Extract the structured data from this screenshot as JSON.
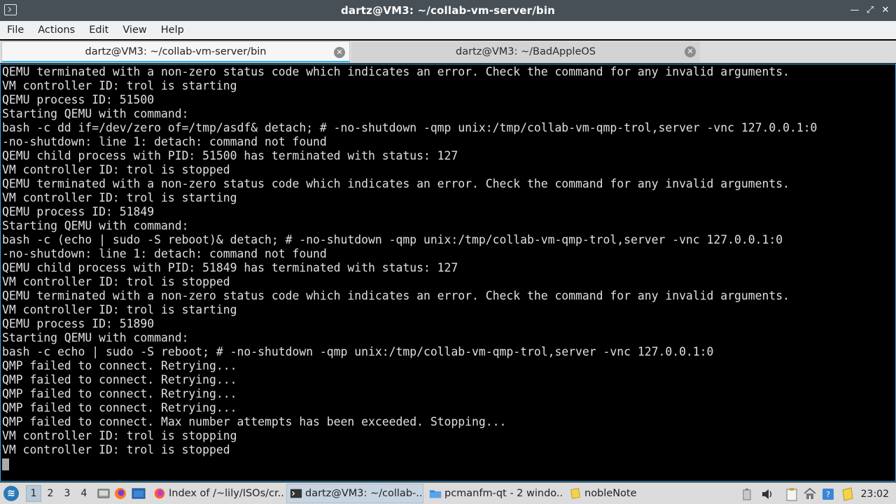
{
  "window": {
    "title": "dartz@VM3: ~/collab-vm-server/bin",
    "icon": "terminal-icon"
  },
  "menu": [
    "File",
    "Actions",
    "Edit",
    "View",
    "Help"
  ],
  "tabs": [
    {
      "label": "dartz@VM3: ~/collab-vm-server/bin",
      "active": true
    },
    {
      "label": "dartz@VM3: ~/BadAppleOS",
      "active": false
    }
  ],
  "terminal": {
    "lines": [
      "QEMU terminated with a non-zero status code which indicates an error. Check the command for any invalid arguments.",
      "VM controller ID: trol is starting",
      "QEMU process ID: 51500",
      "Starting QEMU with command:",
      "bash -c dd if=/dev/zero of=/tmp/asdf& detach; # -no-shutdown -qmp unix:/tmp/collab-vm-qmp-trol,server -vnc 127.0.0.1:0",
      "-no-shutdown: line 1: detach: command not found",
      "QEMU child process with PID: 51500 has terminated with status: 127",
      "VM controller ID: trol is stopped",
      "QEMU terminated with a non-zero status code which indicates an error. Check the command for any invalid arguments.",
      "VM controller ID: trol is starting",
      "QEMU process ID: 51849",
      "Starting QEMU with command:",
      "bash -c (echo | sudo -S reboot)& detach; # -no-shutdown -qmp unix:/tmp/collab-vm-qmp-trol,server -vnc 127.0.0.1:0",
      "-no-shutdown: line 1: detach: command not found",
      "QEMU child process with PID: 51849 has terminated with status: 127",
      "VM controller ID: trol is stopped",
      "QEMU terminated with a non-zero status code which indicates an error. Check the command for any invalid arguments.",
      "VM controller ID: trol is starting",
      "QEMU process ID: 51890",
      "Starting QEMU with command:",
      "bash -c echo | sudo -S reboot; # -no-shutdown -qmp unix:/tmp/collab-vm-qmp-trol,server -vnc 127.0.0.1:0",
      "QMP failed to connect. Retrying...",
      "QMP failed to connect. Retrying...",
      "QMP failed to connect. Retrying...",
      "QMP failed to connect. Retrying...",
      "QMP failed to connect. Max number attempts has been exceeded. Stopping...",
      "VM controller ID: trol is stopping",
      "VM controller ID: trol is stopped"
    ]
  },
  "taskbar": {
    "desktops": [
      "1",
      "2",
      "3",
      "4"
    ],
    "active_desktop": "1",
    "tasks": [
      {
        "label": "Index of /~lily/ISOs/cr...",
        "icon": "firefox-icon"
      },
      {
        "label": "dartz@VM3: ~/collab-...",
        "icon": "terminal-icon",
        "active": true
      },
      {
        "label": "pcmanfm-qt - 2 windo...",
        "icon": "folder-icon"
      },
      {
        "label": "nobleNote",
        "icon": "note-icon"
      }
    ],
    "clock": "23:02"
  },
  "colors": {
    "titlebar": "#475057",
    "accent": "#3daee9",
    "terminal_bg": "#000000",
    "terminal_fg": "#e0e0e0"
  }
}
